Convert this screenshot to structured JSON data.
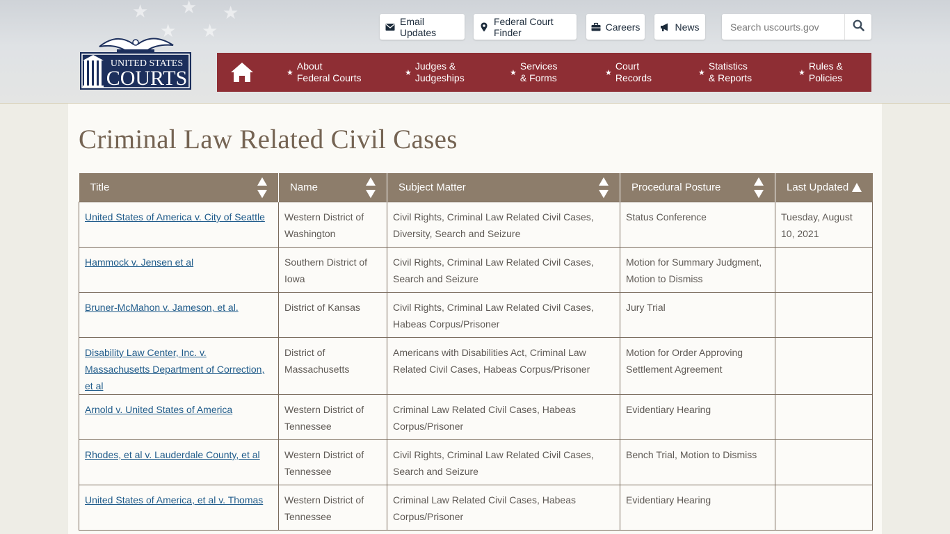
{
  "header": {
    "logo": {
      "line1": "UNITED STATES",
      "line2": "COURTS"
    },
    "utility_buttons": [
      {
        "label": "Email Updates",
        "icon": "envelope-icon"
      },
      {
        "label": "Federal Court Finder",
        "icon": "map-marker-icon"
      },
      {
        "label": "Careers",
        "icon": "briefcase-icon"
      },
      {
        "label": "News",
        "icon": "megaphone-icon"
      }
    ],
    "search": {
      "placeholder": "Search uscourts.gov",
      "icon": "search-icon"
    }
  },
  "nav": {
    "home_icon": "home-icon",
    "items": [
      {
        "line1": "About",
        "line2": "Federal Courts"
      },
      {
        "line1": "Judges &",
        "line2": "Judgeships"
      },
      {
        "line1": "Services",
        "line2": "& Forms"
      },
      {
        "line1": "Court",
        "line2": "Records"
      },
      {
        "line1": "Statistics",
        "line2": "& Reports"
      },
      {
        "line1": "Rules &",
        "line2": "Policies"
      }
    ]
  },
  "page": {
    "title": "Criminal Law Related Civil Cases"
  },
  "table": {
    "headers": [
      "Title",
      "Name",
      "Subject Matter",
      "Procedural Posture",
      "Last Updated"
    ],
    "rows": [
      {
        "title": "United States of America v. City of Seattle",
        "name": "Western District of Washington",
        "subject": "Civil Rights, Criminal Law Related Civil Cases, Diversity, Search and Seizure",
        "posture": "Status Conference",
        "updated": "Tuesday, August 10, 2021"
      },
      {
        "title": "Hammock v. Jensen et al",
        "name": "Southern District of Iowa",
        "subject": "Civil Rights, Criminal Law Related Civil Cases, Search and Seizure",
        "posture": "Motion for Summary Judgment, Motion to Dismiss",
        "updated": ""
      },
      {
        "title": "Bruner-McMahon v. Jameson, et al.",
        "name": "District of Kansas",
        "subject": "Civil Rights, Criminal Law Related Civil Cases, Habeas Corpus/Prisoner",
        "posture": "Jury Trial",
        "updated": ""
      },
      {
        "title": "Disability Law Center, Inc. v. Massachusetts Department of Correction, et al",
        "name": "District of Massachusetts",
        "subject": "Americans with Disabilities Act, Criminal Law Related Civil Cases, Habeas Corpus/Prisoner",
        "posture": "Motion for Order Approving Settlement Agreement",
        "updated": ""
      },
      {
        "title": "Arnold v. United States of America",
        "name": "Western District of Tennessee",
        "subject": "Criminal Law Related Civil Cases, Habeas Corpus/Prisoner",
        "posture": "Evidentiary Hearing",
        "updated": ""
      },
      {
        "title": "Rhodes, et al v. Lauderdale County, et al",
        "name": "Western District of Tennessee",
        "subject": "Civil Rights, Criminal Law Related Civil Cases, Search and Seizure",
        "posture": "Bench Trial, Motion to Dismiss",
        "updated": ""
      },
      {
        "title": "United States of America, et al v. Thomas",
        "name": "Western District of Tennessee",
        "subject": "Criminal Law Related Civil Cases, Habeas Corpus/Prisoner",
        "posture": "Evidentiary Hearing",
        "updated": ""
      }
    ]
  },
  "colors": {
    "nav_bg": "#8e2e34",
    "table_header_bg": "#8d7d6b",
    "title_color": "#756453",
    "link_color": "#1f5b8a"
  }
}
